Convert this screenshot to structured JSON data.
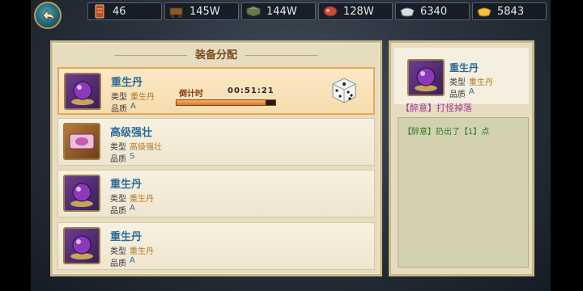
{
  "top_bar": {
    "resources": [
      {
        "icon": "token-icon",
        "value": "46"
      },
      {
        "icon": "cart-icon",
        "value": "145W"
      },
      {
        "icon": "book-icon",
        "value": "144W"
      },
      {
        "icon": "meat-icon",
        "value": "128W"
      },
      {
        "icon": "silver-icon",
        "value": "6340"
      },
      {
        "icon": "gold-icon",
        "value": "5843"
      }
    ]
  },
  "panel": {
    "title": "装备分配",
    "labels": {
      "type": "类型",
      "quality": "品质"
    },
    "items": [
      {
        "name": "重生丹",
        "type": "重生丹",
        "quality": "A",
        "countdown_label": "倒计时",
        "countdown": "00:51:21",
        "progress": 0.9
      },
      {
        "name": "高级强壮",
        "type": "高级强壮",
        "quality": "S"
      },
      {
        "name": "重生丹",
        "type": "重生丹",
        "quality": "A"
      },
      {
        "name": "重生丹",
        "type": "重生丹",
        "quality": "A"
      }
    ]
  },
  "detail": {
    "name": "重生丹",
    "type": "重生丹",
    "quality": "A",
    "drop_text": "【醉意】打怪掉落",
    "log": [
      "【醉意】扔出了【1】点"
    ]
  },
  "colors": {
    "name_blue": "#2b6e9a",
    "value_gold": "#b2762a",
    "drop_purple": "#a3349a",
    "log_green": "#2f7a2a"
  }
}
